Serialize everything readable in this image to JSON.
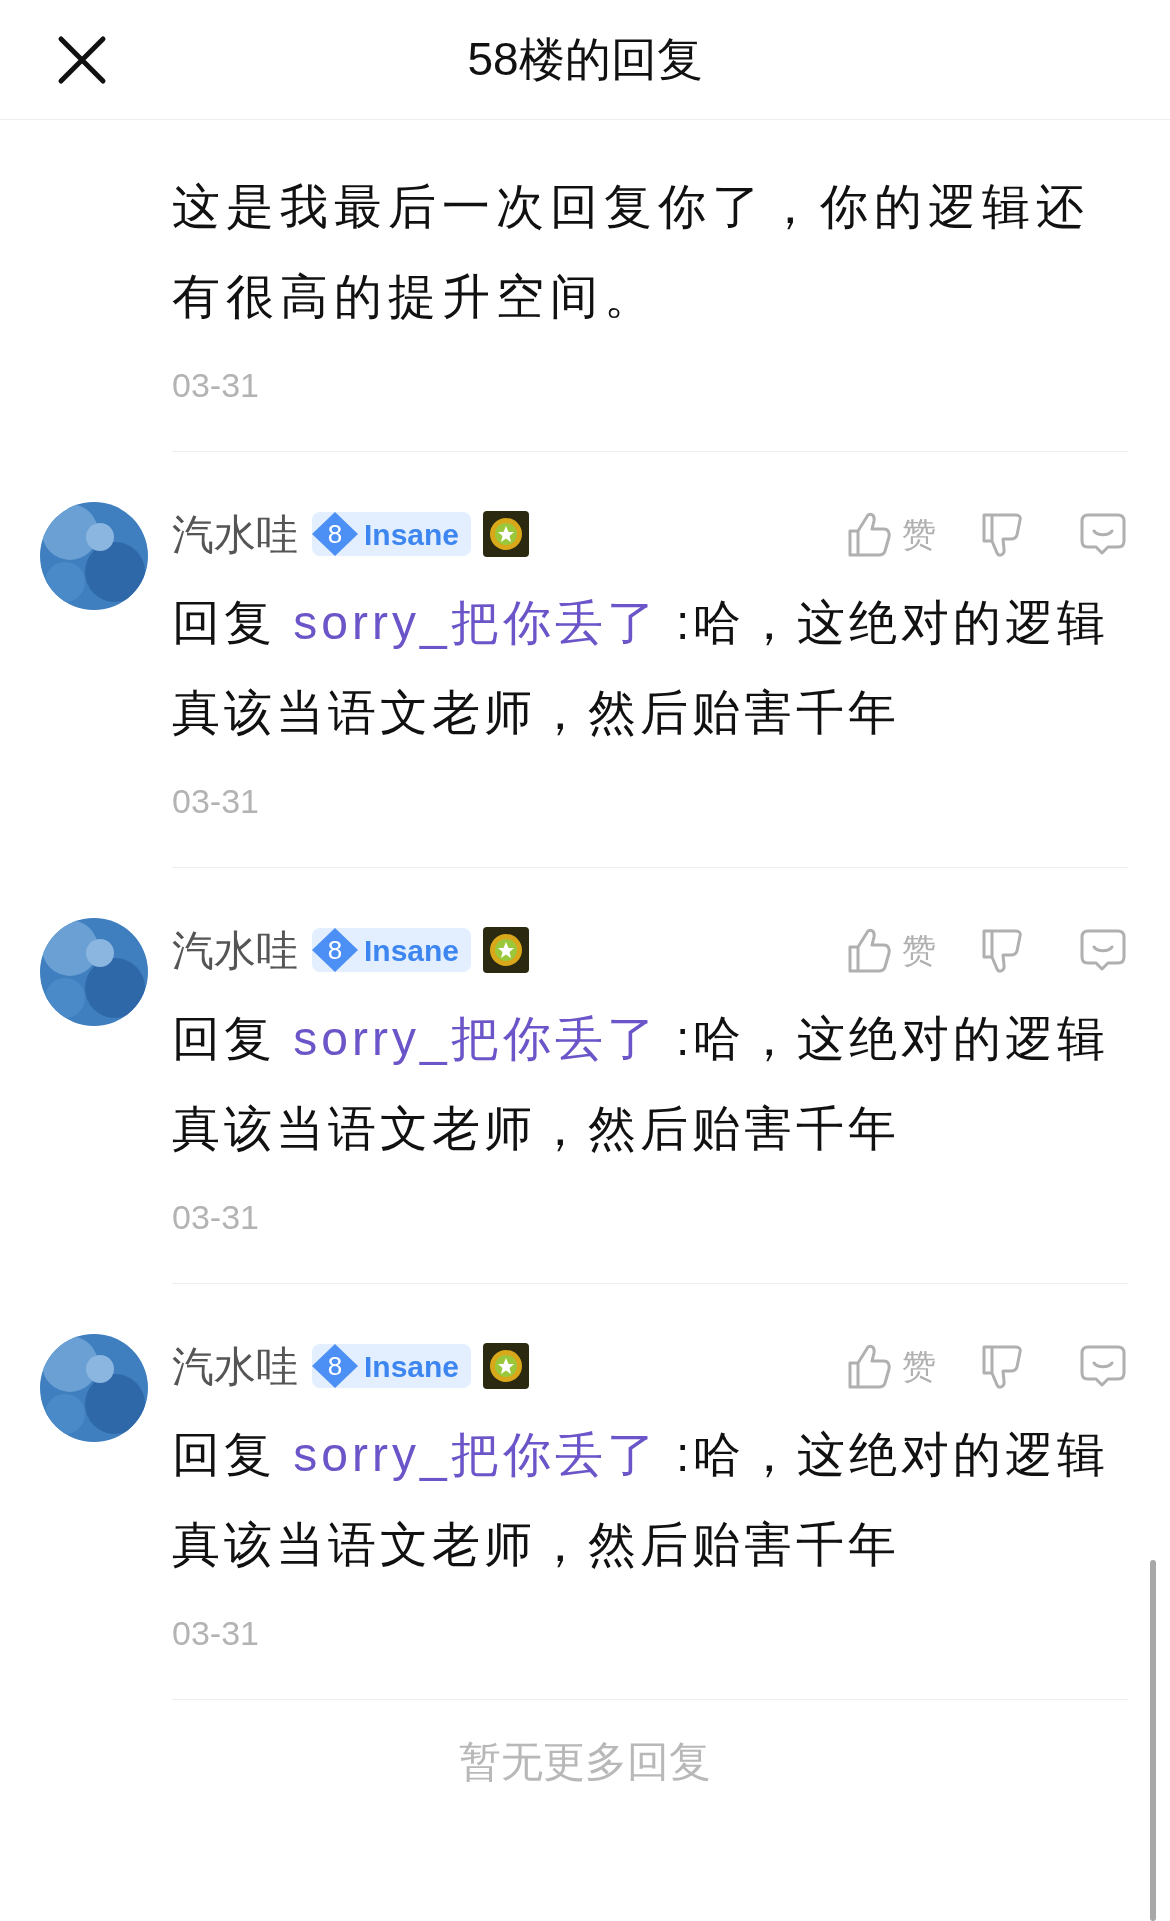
{
  "header": {
    "title": "58楼的回复"
  },
  "previous_reply": {
    "text": "这是我最后一次回复你了，你的逻辑还有很高的提升空间。",
    "date": "03-31"
  },
  "replies": [
    {
      "user": "汽水哇",
      "level": "8",
      "rank": "Insane",
      "prefix": "回复",
      "mention": "sorry_把你丢了",
      "body": ":哈，这绝对的逻辑真该当语文老师，然后贻害千年",
      "date": "03-31",
      "like_label": "赞"
    },
    {
      "user": "汽水哇",
      "level": "8",
      "rank": "Insane",
      "prefix": "回复",
      "mention": "sorry_把你丢了",
      "body": ":哈，这绝对的逻辑真该当语文老师，然后贻害千年",
      "date": "03-31",
      "like_label": "赞"
    },
    {
      "user": "汽水哇",
      "level": "8",
      "rank": "Insane",
      "prefix": "回复",
      "mention": "sorry_把你丢了",
      "body": ":哈，这绝对的逻辑真该当语文老师，然后贻害千年",
      "date": "03-31",
      "like_label": "赞"
    }
  ],
  "footer": "暂无更多回复"
}
